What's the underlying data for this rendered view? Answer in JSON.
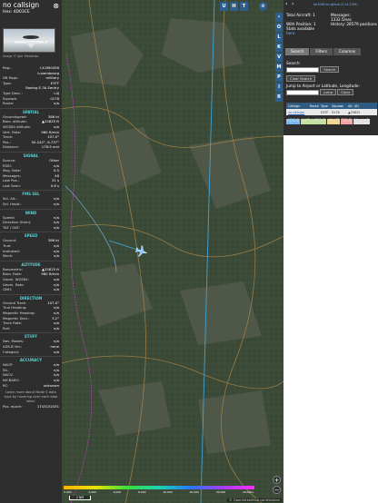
{
  "panel": {
    "callsign": "no callsign",
    "hex": "Hex: 4D03CE",
    "photo_credit": "Image © Igor Metalista"
  },
  "rows": [
    {
      "k": "Reg.:",
      "v": "LX-N90456"
    },
    {
      "k": "",
      "v": "Luxembourg"
    },
    {
      "k": "DB flags:",
      "v": "military"
    },
    {
      "k": "Type:",
      "v": "E3TF"
    },
    {
      "k": "",
      "v": "Boeing E-3A Sentry"
    },
    {
      "k": "Type Desc.:",
      "v": "L4J"
    },
    {
      "k": "Squawk:",
      "v": "0176"
    },
    {
      "k": "Route:",
      "v": "n/a"
    }
  ],
  "sections": {
    "spatial": {
      "title": "SPATIAL",
      "rows": [
        {
          "k": "Groundspeed:",
          "v": "386 kt"
        },
        {
          "k": "Baro. altitude:",
          "v": "▲25825 ft"
        },
        {
          "k": "WGS84 altitude:",
          "v": "n/a"
        },
        {
          "k": "Vert. Rate:",
          "v": "960 ft/min"
        },
        {
          "k": "Track:",
          "v": "107.0°"
        },
        {
          "k": "Pos.:",
          "v": "50.242°, 6.737°"
        },
        {
          "k": "Distance:",
          "v": "178.9 nmi"
        }
      ]
    },
    "signal": {
      "title": "SIGNAL",
      "rows": [
        {
          "k": "Source:",
          "v": "Other"
        },
        {
          "k": "RSSI:",
          "v": "n/a"
        },
        {
          "k": "Msg. Rate:",
          "v": "0.5"
        },
        {
          "k": "Messages:",
          "v": "46"
        },
        {
          "k": "Last Pos.:",
          "v": "31 s"
        },
        {
          "k": "Last Seen:",
          "v": "0.6 s"
        }
      ]
    },
    "fms": {
      "title": "FMS SEL",
      "rows": [
        {
          "k": "Sel. Alt.:",
          "v": "n/a"
        },
        {
          "k": "Sel. Head.:",
          "v": "n/a"
        }
      ]
    },
    "wind": {
      "title": "WIND",
      "rows": [
        {
          "k": "Speed:",
          "v": "n/a"
        },
        {
          "k": "Direction (from):",
          "v": "n/a"
        },
        {
          "k": "TAT / OAT:",
          "v": "n/a"
        }
      ]
    },
    "speed": {
      "title": "SPEED",
      "rows": [
        {
          "k": "Ground:",
          "v": "386 kt"
        },
        {
          "k": "True:",
          "v": "n/a"
        },
        {
          "k": "Indicated:",
          "v": "n/a"
        },
        {
          "k": "Mach:",
          "v": "n/a"
        }
      ]
    },
    "altitude": {
      "title": "ALTITUDE",
      "rows": [
        {
          "k": "Barometric:",
          "v": "▲25825 ft"
        },
        {
          "k": "Baro. Rate:",
          "v": "960 ft/min"
        },
        {
          "k": "Geom. WGS84:",
          "v": "n/a"
        },
        {
          "k": "Geom. Rate:",
          "v": "n/a"
        },
        {
          "k": "QNH:",
          "v": "n/a"
        }
      ]
    },
    "direction": {
      "title": "DIRECTION",
      "rows": [
        {
          "k": "Ground Track:",
          "v": "107.0°"
        },
        {
          "k": "True Heading:",
          "v": "n/a"
        },
        {
          "k": "Magnetic Heading:",
          "v": "n/a"
        },
        {
          "k": "Magnetic Decl.:",
          "v": "3.2°"
        },
        {
          "k": "Track Rate:",
          "v": "n/a"
        },
        {
          "k": "Roll:",
          "v": "n/a"
        }
      ]
    },
    "stuff": {
      "title": "STUFF",
      "rows": [
        {
          "k": "Nav. Modes:",
          "v": "n/a"
        },
        {
          "k": "ADS-B Ver.:",
          "v": "none"
        },
        {
          "k": "Category:",
          "v": "n/a"
        }
      ]
    },
    "accuracy": {
      "title": "ACCURACY",
      "rows": [
        {
          "k": "NACP:",
          "v": "n/a"
        },
        {
          "k": "SIL:",
          "v": "n/a"
        },
        {
          "k": "NACV:",
          "v": "n/a"
        },
        {
          "k": "NICBARO:",
          "v": "n/a"
        },
        {
          "k": "RC:",
          "v": "unknown"
        }
      ]
    }
  },
  "learn_more": "Learn more about Mode S data type by hovering over each data label.",
  "pos_epoch": {
    "k": "Pos. epoch:",
    "v": "1743152431"
  },
  "map": {
    "top_buttons": [
      "U",
      "H",
      "T"
    ],
    "side_buttons": [
      "O",
      "L",
      "K",
      "V",
      "M",
      "P",
      "I",
      "R"
    ],
    "legend_labels": [
      "2,000",
      "4,000",
      "6,000",
      "8,000",
      "10,000",
      "20,000",
      "30,000",
      "40,000+"
    ],
    "scale": "2 NM",
    "attribution": "© OpenStreetMap contributors",
    "zoom_in": "+",
    "zoom_out": "−",
    "colors": {
      "track": "#3fa4d6",
      "aircraft": "#88c6ff",
      "legend_start": "#ffb000",
      "legend_end": "#ff2bff"
    }
  },
  "right": {
    "github": "tar1090 on github (3.14.1709)",
    "total_label": "Total Aircraft:",
    "total_value": "1",
    "pos_label": "With Position:",
    "pos_value": "1",
    "stats_label": "Stats available",
    "stats_link": "here",
    "messages_label": "Messages:",
    "messages_value": "1332.5/sec",
    "history_label": "History:",
    "history_value": "28579 positions",
    "tabs": [
      "Search",
      "Filters",
      "Columns"
    ],
    "search_label": "Search:",
    "search_btn": "Search",
    "clear_search": "Clear Search",
    "jump_label": "Jump to Airport or Latitude, Longitude:",
    "jump_btn": "Jump",
    "clear_btn": "Clear",
    "table_headers": [
      "Callsign",
      "Route",
      "Type",
      "Squawk",
      "Alt. (ft)"
    ],
    "table_row": [
      "no callsign",
      "",
      "E3TF",
      "0176",
      "▲25825"
    ],
    "sources": [
      {
        "label": "ADS-B",
        "bg": "#75b8f0"
      },
      {
        "label": "UAT / ADS-R",
        "bg": "#c4e0a0"
      },
      {
        "label": "MLAT",
        "bg": "#f4d58a"
      },
      {
        "label": "TIS-B",
        "bg": "#f5a3a3"
      },
      {
        "label": "Mode-S",
        "bg": "#e4e4e4"
      }
    ]
  }
}
